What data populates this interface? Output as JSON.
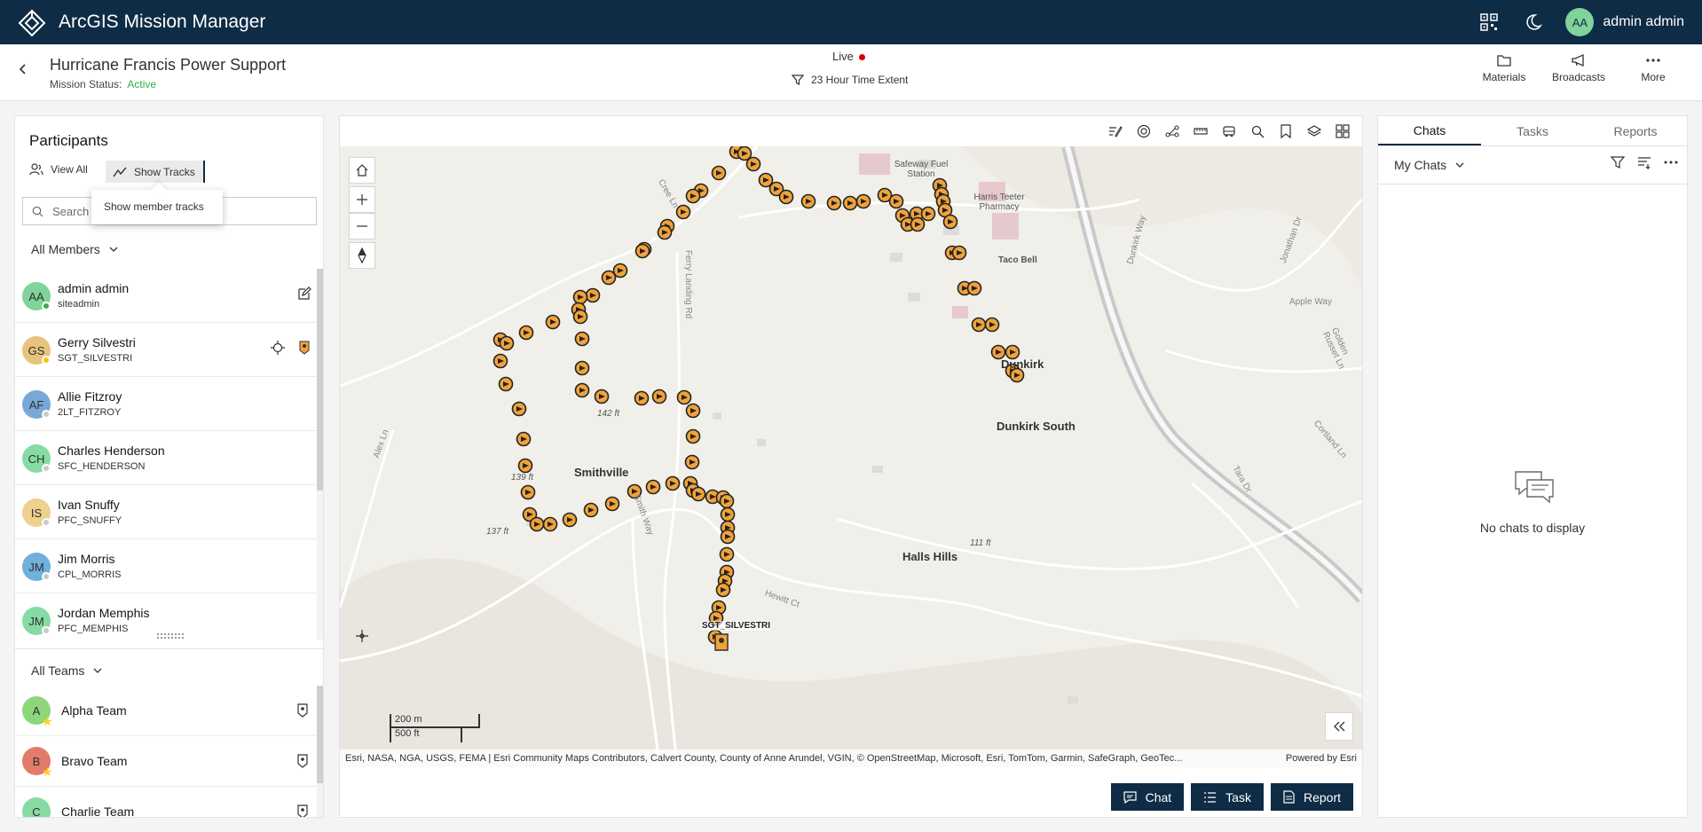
{
  "app": {
    "title": "ArcGIS Mission Manager"
  },
  "user": {
    "initials": "AA",
    "name": "admin admin"
  },
  "mission": {
    "title": "Hurricane Francis Power Support",
    "status_label": "Mission Status:",
    "status_value": "Active",
    "live_label": "Live",
    "time_extent": "23 Hour Time Extent"
  },
  "header_actions": [
    {
      "label": "Materials",
      "icon": "folder-icon"
    },
    {
      "label": "Broadcasts",
      "icon": "megaphone-icon"
    },
    {
      "label": "More",
      "icon": "more-icon"
    }
  ],
  "participants": {
    "title": "Participants",
    "view_all": "View All",
    "show_tracks": "Show Tracks",
    "tooltip": "Show member tracks",
    "search_placeholder": "Search",
    "members_filter": "All Members",
    "members": [
      {
        "initials": "AA",
        "name": "admin admin",
        "username": "siteadmin",
        "color": "#7fd39b",
        "status": "#35ac46"
      },
      {
        "initials": "GS",
        "name": "Gerry Silvestri",
        "username": "SGT_SILVESTRI",
        "color": "#e8c37f",
        "status": "#f5c400"
      },
      {
        "initials": "AF",
        "name": "Allie Fitzroy",
        "username": "2LT_FITZROY",
        "color": "#79a8d8",
        "status": "#c9c9c9"
      },
      {
        "initials": "CH",
        "name": "Charles Henderson",
        "username": "SFC_HENDERSON",
        "color": "#86dba3",
        "status": "#c9c9c9"
      },
      {
        "initials": "IS",
        "name": "Ivan Snuffy",
        "username": "PFC_SNUFFY",
        "color": "#efd08c",
        "status": "#c9c9c9"
      },
      {
        "initials": "JM",
        "name": "Jim Morris",
        "username": "CPL_MORRIS",
        "color": "#6fb0dd",
        "status": "#c9c9c9"
      },
      {
        "initials": "JM",
        "name": "Jordan Memphis",
        "username": "PFC_MEMPHIS",
        "color": "#86dba3",
        "status": "#c9c9c9"
      }
    ],
    "teams_filter": "All Teams",
    "teams": [
      {
        "initials": "A",
        "name": "Alpha Team",
        "color": "#8ed67a"
      },
      {
        "initials": "B",
        "name": "Bravo Team",
        "color": "#e37b6a"
      },
      {
        "initials": "C",
        "name": "Charlie Team",
        "color": "#86dba3"
      }
    ]
  },
  "map": {
    "places": [
      "Safeway Fuel Station",
      "Harris Teeter Pharmacy",
      "Taco Bell",
      "Dunkirk",
      "Dunkirk South",
      "Smithville",
      "Halls Hills"
    ],
    "elevations": [
      "142 ft",
      "139 ft",
      "137 ft",
      "111 ft"
    ],
    "roads": [
      "Cree Ln",
      "Ferry Landing Rd",
      "Smith Way",
      "Hewitt Ct",
      "Alex Ln",
      "Apple Way",
      "Dunkirk Way",
      "Jonathan Dr",
      "Tara Dr",
      "Cortland Ln",
      "Golden Russet Ln"
    ],
    "member_label": "SGT_SILVESTRI",
    "scale_metric": "200 m",
    "scale_imperial": "500 ft",
    "attribution": "Esri, NASA, NGA, USGS, FEMA | Esri Community Maps Contributors, Calvert County, County of Anne Arundel, VGIN, © OpenStreetMap, Microsoft, Esri, TomTom, Garmin, SafeGraph, GeoTec...",
    "powered_by": "Powered by Esri",
    "track_color": "#f0a33a",
    "actions": [
      {
        "label": "Chat"
      },
      {
        "label": "Task"
      },
      {
        "label": "Report"
      }
    ]
  },
  "right_panel": {
    "tabs": [
      "Chats",
      "Tasks",
      "Reports"
    ],
    "chat_filter": "My Chats",
    "empty_text": "No chats to display"
  }
}
